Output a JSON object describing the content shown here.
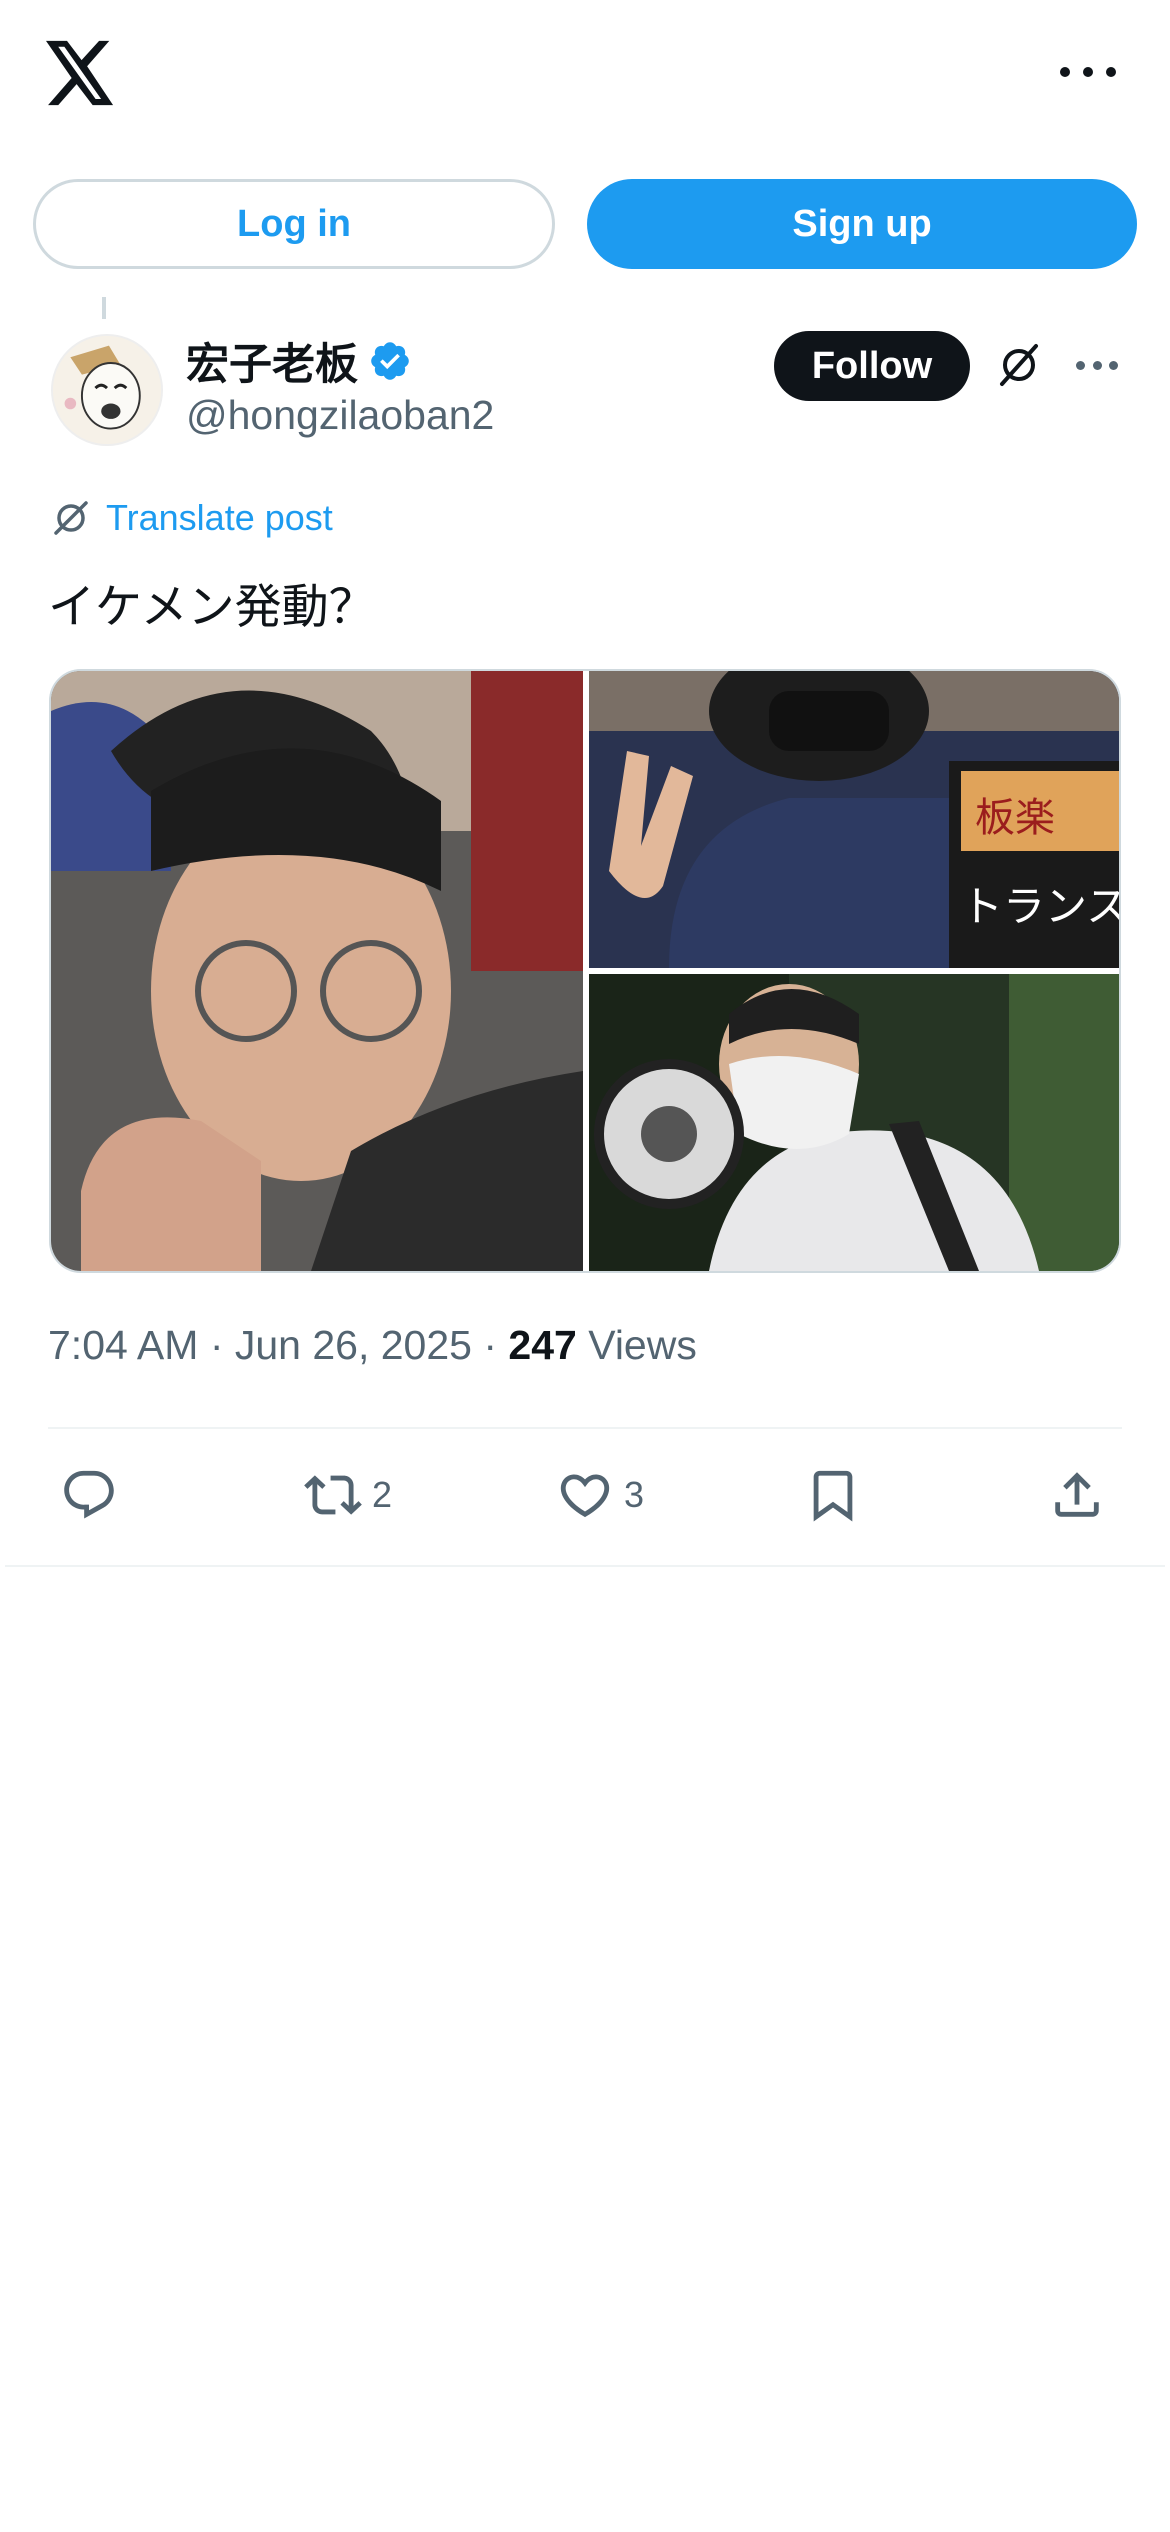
{
  "header": {
    "logo_icon": "x-logo-icon",
    "more_icon": "more-horizontal-icon"
  },
  "auth": {
    "login_label": "Log in",
    "signup_label": "Sign up"
  },
  "post": {
    "author_name": "宏子老板",
    "verified_icon": "verified-badge-icon",
    "handle": "@hongzilaoban2",
    "follow_label": "Follow",
    "translate_label": "Translate post",
    "text": "イケメン発動？",
    "media_count": 3,
    "timestamp": "7:04 AM · Jun 26, 2025 · ",
    "views_count": "247",
    "views_label": "Views"
  },
  "actions": {
    "reply_count": "",
    "retweet_count": "2",
    "like_count": "3",
    "bookmark_count": "",
    "share_icon": "share-icon"
  },
  "colors": {
    "accent": "#1d9bf0",
    "text_primary": "#0f1419",
    "text_secondary": "#536471",
    "border": "#cfd9de"
  }
}
